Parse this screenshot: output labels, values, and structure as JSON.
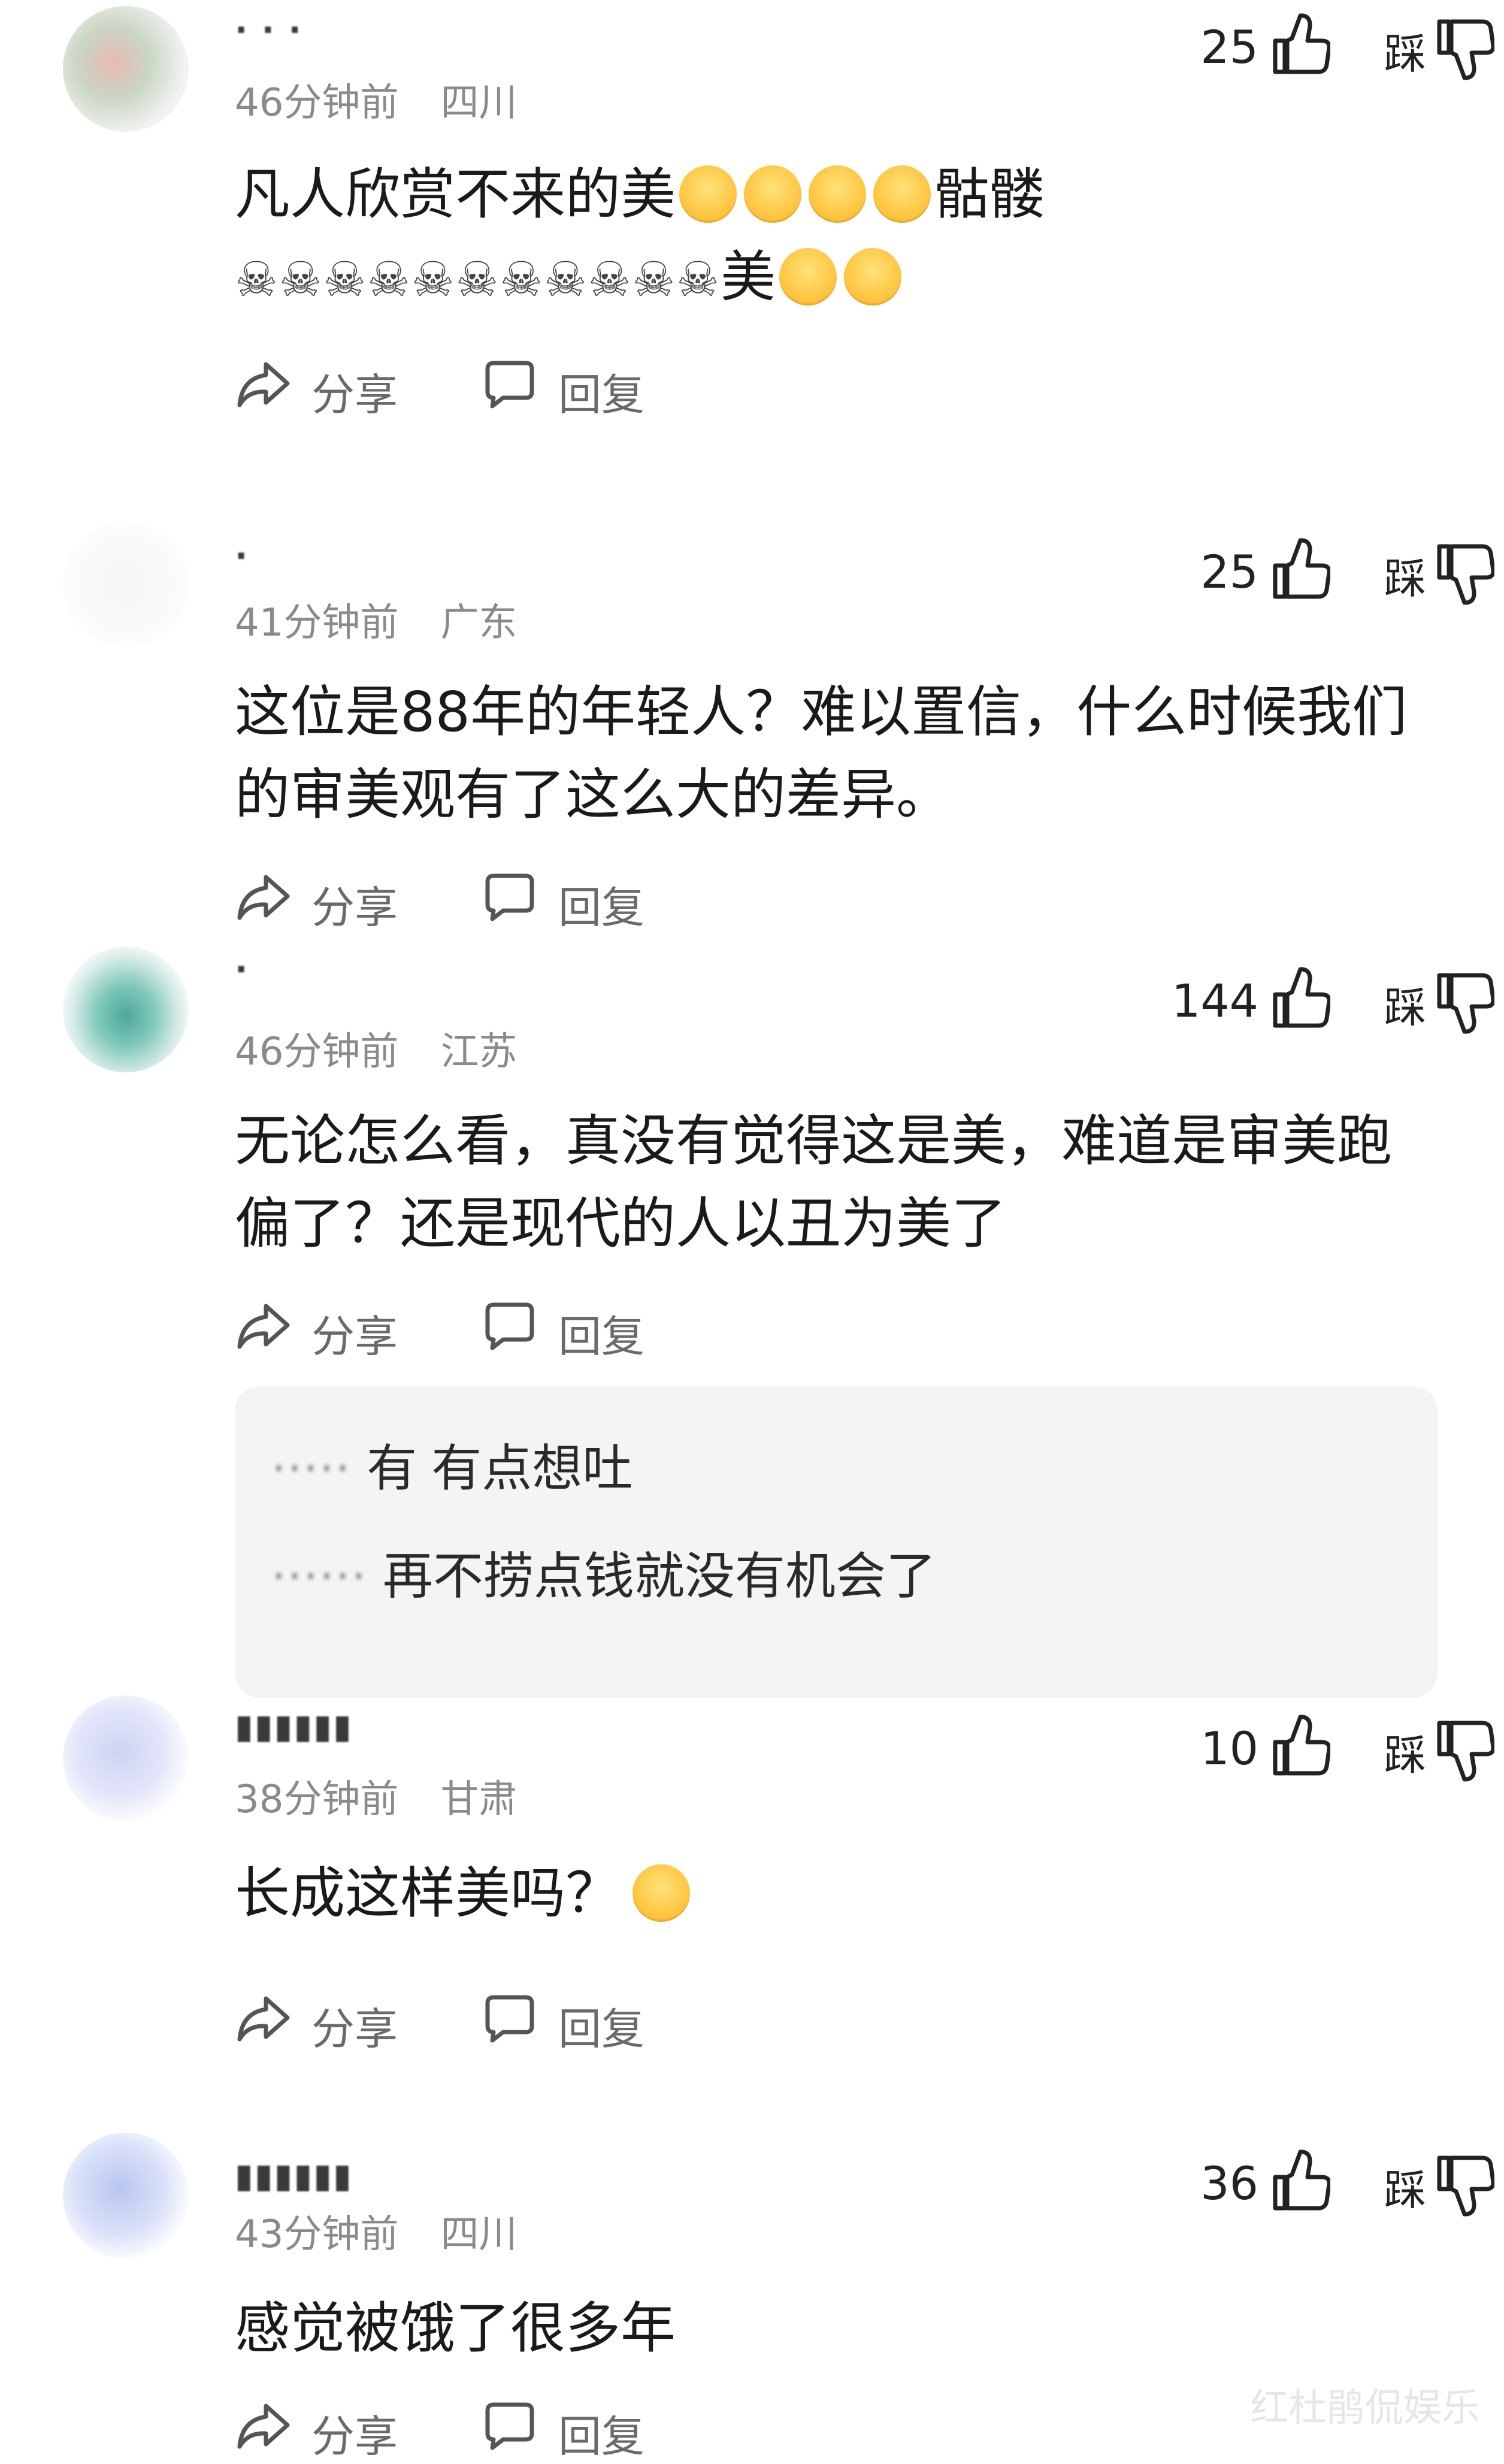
{
  "comments": [
    {
      "likes": "25",
      "caicai": "踩",
      "time": "46分钟前",
      "location": "四川",
      "text_line1": "凡人欣赏不来的美",
      "text_line1_tail": "骷髅",
      "text_line2_skulls": "☠☠☠☠☠☠☠☠☠☠☠",
      "text_line2_tail": "美",
      "emoji_line1": [
        "grin-emoji",
        "wink-tongue-emoji",
        "wink-tongue-emoji",
        "wink-tongue-emoji"
      ],
      "emoji_line2": [
        "grin-emoji",
        "wink-tongue-emoji"
      ]
    },
    {
      "likes": "25",
      "caicai": "踩",
      "time": "41分钟前",
      "location": "广东",
      "text": "这位是88年的年轻人？难以置信，什么时候我们的审美观有了这么大的差异。"
    },
    {
      "likes": "144",
      "caicai": "踩",
      "time": "46分钟前",
      "location": "江苏",
      "text": "无论怎么看，真没有觉得这是美，难道是审美跑偏了？还是现代的人以丑为美了",
      "replies": [
        {
          "prefix": "有",
          "text": "有点想吐"
        },
        {
          "prefix": "",
          "text": "再不捞点钱就没有机会了"
        }
      ]
    },
    {
      "likes": "10",
      "caicai": "踩",
      "time": "38分钟前",
      "location": "甘肃",
      "text": "长成这样美吗？",
      "emoji": "shocked-emoji"
    },
    {
      "likes": "36",
      "caicai": "踩",
      "time": "43分钟前",
      "location": "四川",
      "text": "感觉被饿了很多年"
    }
  ],
  "actions": {
    "share_label": "分享",
    "reply_label": "回复"
  },
  "watermark": "红杜鹃侃娱乐"
}
